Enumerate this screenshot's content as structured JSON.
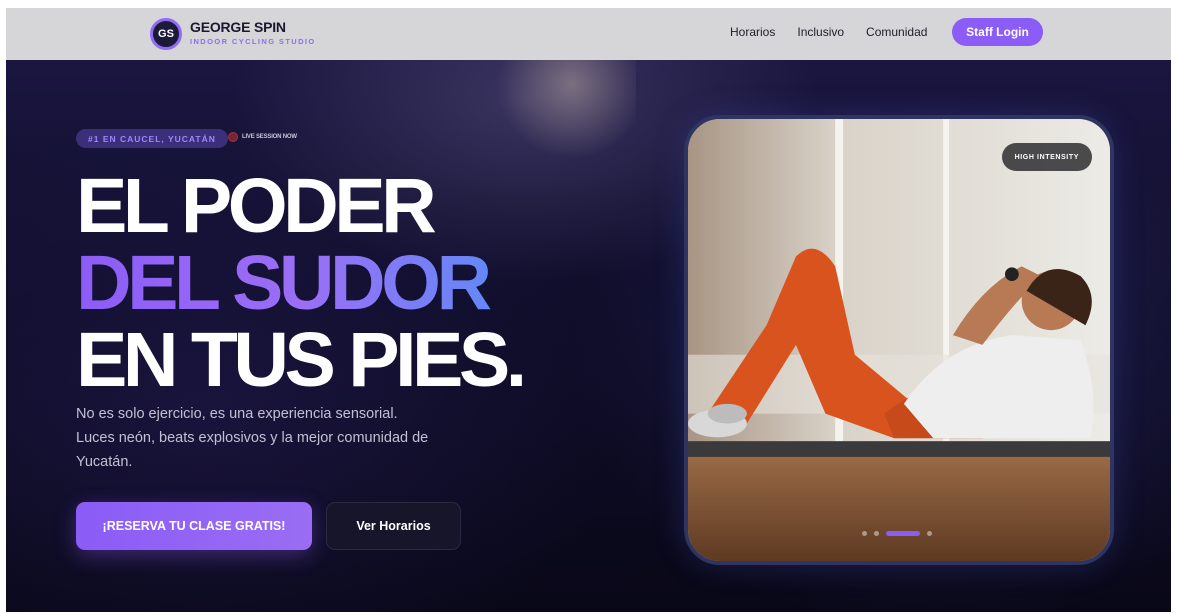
{
  "nav": {
    "logo_mark": "GS",
    "brand": "GEORGE SPIN",
    "tagline": "INDOOR CYCLING STUDIO",
    "links": [
      {
        "label": "Horarios"
      },
      {
        "label": "Inclusivo"
      },
      {
        "label": "Comunidad"
      }
    ],
    "staff_login": "Staff Login"
  },
  "hero": {
    "location_badge": "#1 EN CAUCEL, YUCATÁN",
    "live_label": "LIVE SESSION NOW",
    "headline": {
      "line1": "EL PODER",
      "line2": "DEL SUDOR",
      "line3": "EN TUS PIES."
    },
    "description": "No es solo ejercicio, es una experiencia sensorial. Luces neón, beats explosivos y la mejor comunidad de Yucatán.",
    "cta_primary": "¡RESERVA TU CLASE GRATIS!",
    "cta_secondary": "Ver Horarios"
  },
  "card": {
    "badge": "HIGH INTENSITY",
    "carousel": {
      "count": 4,
      "active_index": 2
    }
  },
  "colors": {
    "accent": "#8b5cf6",
    "hero_bg": "#0e0c24",
    "nav_bg": "#d6d6d8",
    "headline_gradient_end": "#5b8cf7"
  }
}
